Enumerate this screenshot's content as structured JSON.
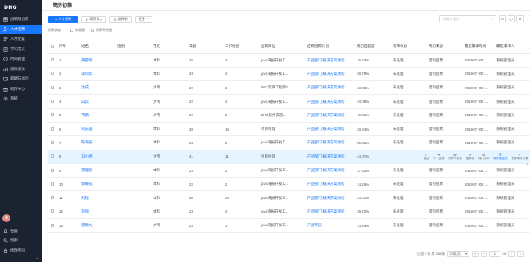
{
  "sidebar": {
    "logo": "DHG",
    "items": [
      {
        "label": "战略与组织",
        "icon": "dashboard-icon",
        "active": false
      },
      {
        "label": "人才招聘",
        "icon": "user-add-icon",
        "active": true
      },
      {
        "label": "人才配置",
        "icon": "team-icon",
        "active": false
      },
      {
        "label": "学习成长",
        "icon": "book-icon",
        "active": false
      },
      {
        "label": "时间管理",
        "icon": "clock-icon",
        "active": false
      },
      {
        "label": "绩效绩效",
        "icon": "chart-icon",
        "active": false
      },
      {
        "label": "薪酬与福利",
        "icon": "wallet-icon",
        "active": false
      },
      {
        "label": "跨界中心",
        "icon": "gift-icon",
        "active": false
      },
      {
        "label": "系统",
        "icon": "settings-icon",
        "active": false
      }
    ],
    "bottom": [
      {
        "label": "名誉",
        "icon": "bell-icon"
      },
      {
        "label": "搜索",
        "icon": "search-icon"
      },
      {
        "label": "修改密码",
        "icon": "lock-icon"
      }
    ],
    "collapse_glyph": "«"
  },
  "header": {
    "title": "简历初筛"
  },
  "toolbar": {
    "add_label": "人才招聘",
    "import_label": "简历导入",
    "select_label": "选择职",
    "more_label": "更多",
    "search_placeholder": "请输入搜索..."
  },
  "filter": {
    "label": "初筛状态：",
    "options": [
      "未处理",
      "初筛不合格"
    ]
  },
  "table": {
    "headers": [
      "序号",
      "姓名",
      "性别",
      "学历",
      "年龄",
      "工作经验",
      "应聘岗位",
      "应聘招聘计划",
      "简历匹配度",
      "初筛状态",
      "简历来源",
      "最近操作时间",
      "最近操作人"
    ],
    "rows": [
      [
        "1",
        "黄雷辉",
        "",
        "本科",
        "25",
        "3",
        "java海报开发工...",
        "产品部门-解决方案顾问",
        "15.63%",
        "未处理",
        "猎狗招聘",
        "2019-07-08 1...",
        "系统管理员"
      ],
      [
        "2",
        "李阿华",
        "",
        "本科",
        "23",
        "2",
        "java海报开发工...",
        "产品部门-解决方案顾问",
        "38.79%",
        "未处理",
        "猎狗招聘",
        "2019-07-08 1...",
        "系统管理员"
      ],
      [
        "3",
        "沈成",
        "",
        "大专",
        "22",
        "2",
        "NET软件工程师?",
        "产品部门-解决方案顾问",
        "13.05%",
        "未处理",
        "猎狗招聘",
        "2019-07-08 1...",
        "系统管理员"
      ],
      [
        "4",
        "白云",
        "",
        "大专",
        "22",
        "2",
        "java海报开发工...",
        "产品部门-解决方案顾问",
        "40.09%",
        "未处理",
        "猎狗招聘",
        "2019-07-08 1...",
        "系统管理员"
      ],
      [
        "5",
        "韦鹏",
        "",
        "大专",
        "22",
        "2",
        "EHR软件实施...",
        "产品部门-解决方案顾问",
        "49.01%",
        "未处理",
        "猎狗招聘",
        "2019-07-08 1...",
        "系统管理员"
      ],
      [
        "6",
        "刘志强",
        "",
        "本科",
        "38",
        "14",
        "项目经理",
        "产品部门-解决方案顾问",
        "29.04%",
        "未处理",
        "猎狗招聘",
        "2019-07-08 1...",
        "系统管理员"
      ],
      [
        "7",
        "陈海波",
        "",
        "本科",
        "23",
        "2",
        "java海报开发工...",
        "产品部门-解决方案顾问",
        "55.31%",
        "未处理",
        "猎狗招聘",
        "2019-07-08 1...",
        "系统管理员"
      ],
      [
        "8",
        "马小明",
        "",
        "大专",
        "41",
        "11",
        "项目经理",
        "产品部门-解决方案顾问",
        "44.07%",
        "",
        "",
        "",
        ""
      ],
      [
        "9",
        "黄理云",
        "",
        "本科",
        "23",
        "2",
        "java海报开发工...",
        "产品部门-解决方案顾问",
        "37.22%",
        "未处理",
        "猎狗招聘",
        "2019-07-08 1...",
        "系统管理员"
      ],
      [
        "10",
        "郭耀成",
        "",
        "本科",
        "22",
        "2",
        "java海报开发工...",
        "产品部门-解决方案顾问",
        "14.26%",
        "未处理",
        "猎狗招聘",
        "2019-07-08 1...",
        "系统管理员"
      ],
      [
        "11",
        "刘程",
        "",
        "本科",
        "50",
        "24",
        "java海报开发工...",
        "产品部门-解决方案顾问",
        "24.01%",
        "未处理",
        "猎狗招聘",
        "2019-07-08 1...",
        "系统管理员"
      ],
      [
        "12",
        "刘强",
        "",
        "本科",
        "23",
        "2",
        "java海报开发工...",
        "产品部门-解决方案顾问",
        "39.72%",
        "未处理",
        "猎狗招聘",
        "2019-07-08 1...",
        "系统管理员"
      ],
      [
        "13",
        "骆晚九",
        "",
        "大专",
        "24",
        "3",
        "java海报开发工...",
        "产品专员",
        "14.29%",
        "未处理",
        "猎狗招聘",
        "2019-07-08 1...",
        "系统管理员"
      ]
    ],
    "highlight_row": 7,
    "row_actions": [
      {
        "label": "通过",
        "icon": "check-circle-icon"
      },
      {
        "label": "下一面试",
        "icon": "next-icon"
      },
      {
        "label": "初筛不合格",
        "icon": "close-circle-icon"
      },
      {
        "label": "推荐者",
        "icon": "recommend-icon"
      },
      {
        "label": "转入才库",
        "icon": "database-icon"
      },
      {
        "label": "转作成面试",
        "icon": "interview-icon",
        "accent": true
      },
      {
        "label": "查看简历记录",
        "icon": "add-icon"
      }
    ]
  },
  "pager": {
    "summary": "已加 0 条  共 238 条",
    "page_size": "15条/页",
    "page_current": "1",
    "page_total": "/16",
    "first": "«",
    "prev": "‹",
    "next": "›",
    "last": "»"
  },
  "colors": {
    "accent": "#1677ff",
    "sidebar_bg": "#1b2330",
    "highlight_row": "#e6f4ff"
  }
}
